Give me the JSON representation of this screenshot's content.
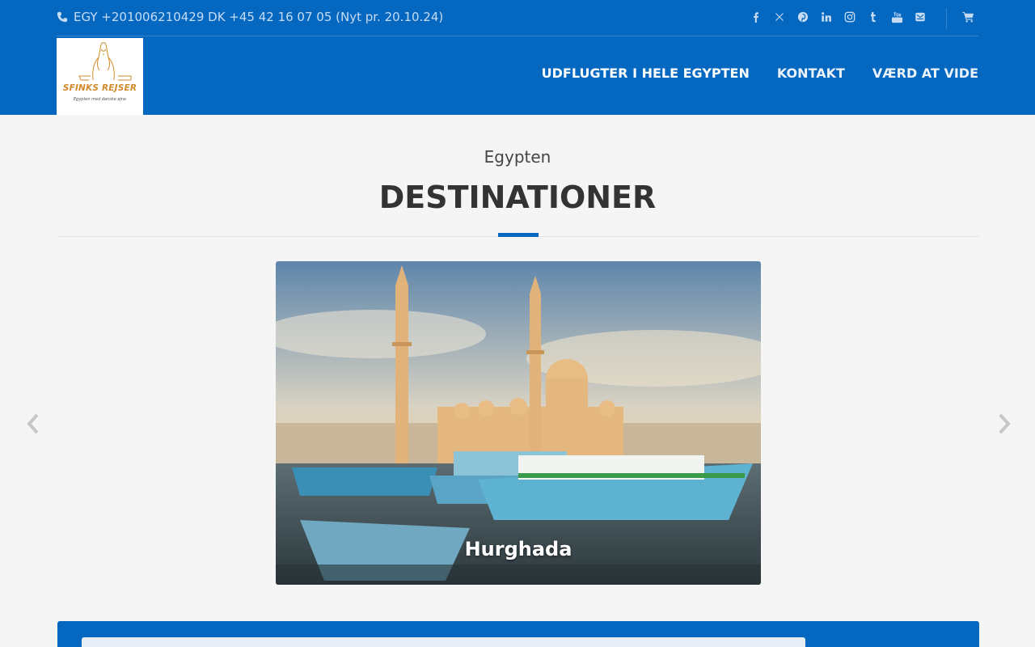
{
  "topbar": {
    "contact_text": "EGY +201006210429 DK +45 42 16 07 05 (Nyt pr. 20.10.24)",
    "social_icons": [
      "facebook-icon",
      "x-twitter-icon",
      "pinterest-icon",
      "linkedin-icon",
      "instagram-icon",
      "tumblr-icon",
      "youtube-icon",
      "email-icon"
    ],
    "cart_icon": "cart-icon"
  },
  "logo": {
    "brand": "SFINKS REJSER",
    "tagline": "Egypten med danske øjne"
  },
  "nav": {
    "items": [
      "UDFLUGTER I HELE EGYPTEN",
      "KONTAKT",
      "VÆRD AT VIDE"
    ]
  },
  "section": {
    "subtitle": "Egypten",
    "title": "DESTINATIONER"
  },
  "carousel": {
    "current_caption": "Hurghada",
    "prev_icon": "chevron-left-icon",
    "next_icon": "chevron-right-icon"
  },
  "colors": {
    "brand_blue": "#0467c0",
    "background": "#f5f5f5",
    "logo_gold": "#d18b2c"
  }
}
